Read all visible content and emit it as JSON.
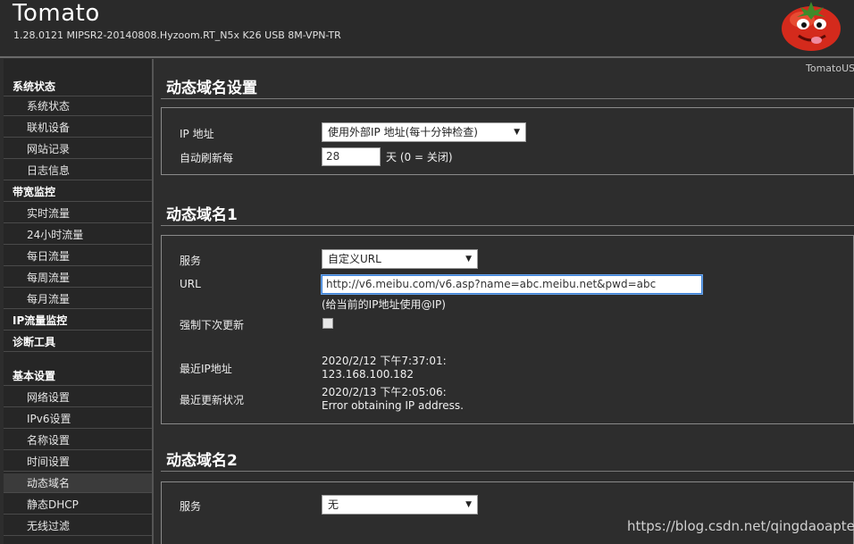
{
  "header": {
    "title": "Tomato",
    "version": "1.28.0121 MIPSR2-20140808.Hyzoom.RT_N5x K26 USB 8M-VPN-TR",
    "brand_corner": "TomatoUS"
  },
  "sidebar": {
    "items": [
      {
        "label": "系统状态",
        "kind": "section"
      },
      {
        "label": "系统状态",
        "kind": "item"
      },
      {
        "label": "联机设备",
        "kind": "item"
      },
      {
        "label": "网站记录",
        "kind": "item"
      },
      {
        "label": "日志信息",
        "kind": "item"
      },
      {
        "label": "带宽监控",
        "kind": "section"
      },
      {
        "label": "实时流量",
        "kind": "item"
      },
      {
        "label": "24小时流量",
        "kind": "item"
      },
      {
        "label": "每日流量",
        "kind": "item"
      },
      {
        "label": "每周流量",
        "kind": "item"
      },
      {
        "label": "每月流量",
        "kind": "item"
      },
      {
        "label": "IP流量监控",
        "kind": "section"
      },
      {
        "label": "诊断工具",
        "kind": "section"
      },
      {
        "label": "基本设置",
        "kind": "section"
      },
      {
        "label": "网络设置",
        "kind": "item"
      },
      {
        "label": "IPv6设置",
        "kind": "item"
      },
      {
        "label": "名称设置",
        "kind": "item"
      },
      {
        "label": "时间设置",
        "kind": "item"
      },
      {
        "label": "动态域名",
        "kind": "item",
        "active": true
      },
      {
        "label": "静态DHCP",
        "kind": "item"
      },
      {
        "label": "无线过滤",
        "kind": "item"
      }
    ]
  },
  "ddns_settings": {
    "title": "动态域名设置",
    "ip_label": "IP 地址",
    "ip_value": "使用外部IP 地址(每十分钟检查)",
    "refresh_label": "自动刷新每",
    "refresh_value": "28",
    "refresh_unit": "天 (0 = 关闭)"
  },
  "ddns1": {
    "title": "动态域名1",
    "service_label": "服务",
    "service_value": "自定义URL",
    "url_label": "URL",
    "url_value": "http://v6.meibu.com/v6.asp?name=abc.meibu.net&pwd=abc",
    "url_hint": "(给当前的IP地址使用@IP)",
    "force_label": "强制下次更新",
    "last_ip_label": "最近IP地址",
    "last_ip_time": "2020/2/12 下午7:37:01:",
    "last_ip_value": "123.168.100.182",
    "last_status_label": "最近更新状况",
    "last_status_time": "2020/2/13 下午2:05:06:",
    "last_status_value": "Error obtaining IP address."
  },
  "ddns2": {
    "title": "动态域名2",
    "service_label": "服务",
    "service_value": "无"
  },
  "watermark": "https://blog.csdn.net/qingdaoaptea"
}
